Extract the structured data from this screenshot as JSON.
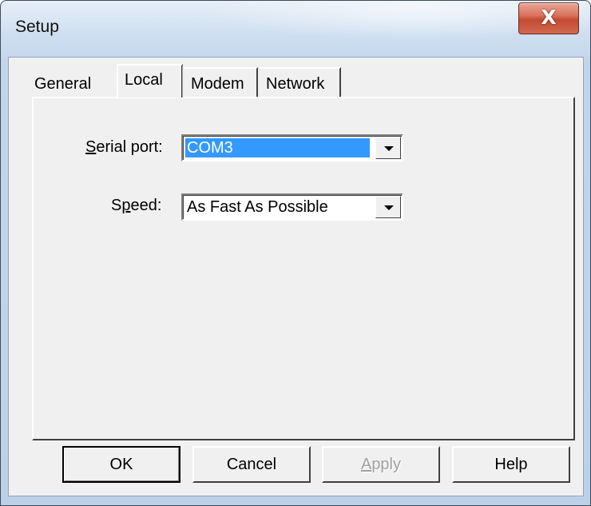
{
  "window": {
    "title": "Setup",
    "close_glyph": "X",
    "close_icon": "close-icon"
  },
  "tabs": [
    {
      "label": "General",
      "active": false
    },
    {
      "label": "Local",
      "active": true
    },
    {
      "label": "Modem",
      "active": false
    },
    {
      "label": "Network",
      "active": false
    }
  ],
  "local": {
    "serial_port": {
      "label_mnemonic": "S",
      "label_rest": "erial port:",
      "value": "COM3"
    },
    "speed": {
      "label_first": "S",
      "label_mnemonic": "p",
      "label_rest": "eed:",
      "value": "As Fast As Possible"
    }
  },
  "buttons": {
    "ok": "OK",
    "cancel": "Cancel",
    "apply_mnemonic": "A",
    "apply_rest": "pply",
    "help": "Help"
  },
  "colors": {
    "selection": "#3399ff",
    "dialog_face": "#f0f0f0",
    "close_button": "#c24a31"
  }
}
